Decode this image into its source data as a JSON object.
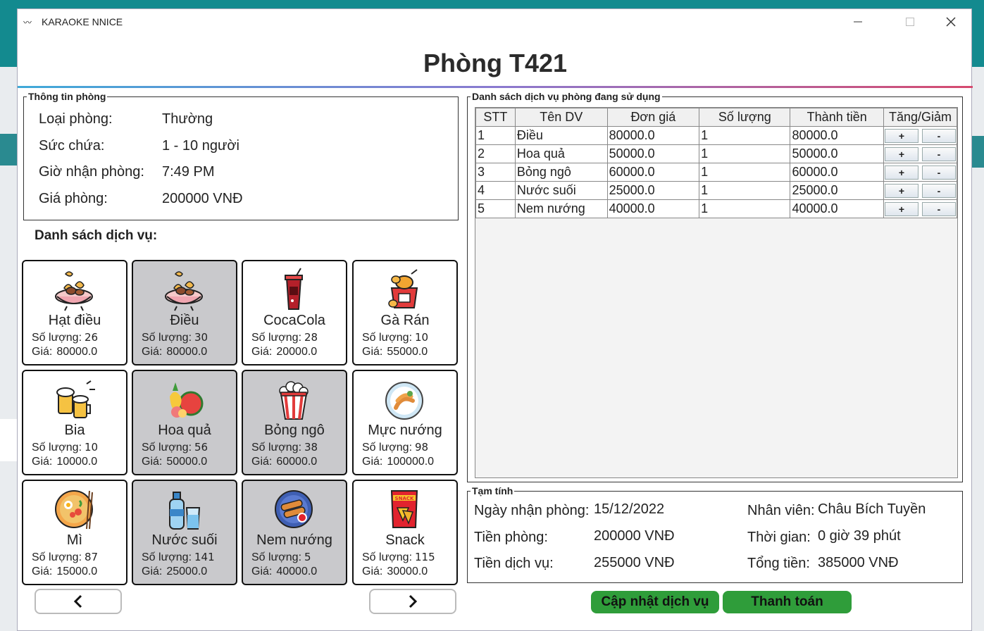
{
  "window": {
    "title": "KARAOKE NNICE"
  },
  "room": {
    "title": "Phòng T421"
  },
  "room_info": {
    "legend": "Thông tin phòng",
    "rows": [
      {
        "label": "Loại phòng:",
        "value": "Thường"
      },
      {
        "label": "Sức chứa:",
        "value": "1 - 10 người"
      },
      {
        "label": "Giờ nhận phòng:",
        "value": "7:49 PM"
      },
      {
        "label": "Giá phòng:",
        "value": "200000 VNĐ"
      }
    ]
  },
  "services": {
    "heading": "Danh sách dịch vụ:",
    "qty_label": "Số lượng:",
    "price_label": "Giá:",
    "items": [
      {
        "name": "Hạt điều",
        "qty": "26",
        "price": "80000.0",
        "icon": "cashew-icon",
        "selected": false
      },
      {
        "name": "Điều",
        "qty": "30",
        "price": "80000.0",
        "icon": "cashew-icon",
        "selected": true
      },
      {
        "name": "CocaCola",
        "qty": "28",
        "price": "20000.0",
        "icon": "soda-cup-icon",
        "selected": false
      },
      {
        "name": "Gà Rán",
        "qty": "10",
        "price": "55000.0",
        "icon": "fried-chicken-icon",
        "selected": false
      },
      {
        "name": "Bia",
        "qty": "10",
        "price": "10000.0",
        "icon": "beer-icon",
        "selected": false
      },
      {
        "name": "Hoa quả",
        "qty": "56",
        "price": "50000.0",
        "icon": "fruit-icon",
        "selected": true
      },
      {
        "name": "Bỏng ngô",
        "qty": "38",
        "price": "60000.0",
        "icon": "popcorn-icon",
        "selected": true
      },
      {
        "name": "Mực nướng",
        "qty": "98",
        "price": "100000.0",
        "icon": "grilled-squid-icon",
        "selected": false
      },
      {
        "name": "Mì",
        "qty": "87",
        "price": "15000.0",
        "icon": "noodle-bowl-icon",
        "selected": false
      },
      {
        "name": "Nước suối",
        "qty": "141",
        "price": "25000.0",
        "icon": "water-bottle-icon",
        "selected": true
      },
      {
        "name": "Nem nướng",
        "qty": "5",
        "price": "40000.0",
        "icon": "grilled-sausage-icon",
        "selected": true
      },
      {
        "name": "Snack",
        "qty": "115",
        "price": "30000.0",
        "icon": "snack-bag-icon",
        "selected": false
      }
    ],
    "prev": "‹",
    "next": "›"
  },
  "used_services": {
    "legend": "Danh sách dịch vụ phòng đang sử dụng",
    "columns": [
      "STT",
      "Tên DV",
      "Đơn giá",
      "Số lượng",
      "Thành tiền",
      "Tăng/Giảm"
    ],
    "plus": "+",
    "minus": "-",
    "rows": [
      [
        "1",
        "Điều",
        "80000.0",
        "1",
        "80000.0"
      ],
      [
        "2",
        "Hoa quả",
        "50000.0",
        "1",
        "50000.0"
      ],
      [
        "3",
        "Bỏng ngô",
        "60000.0",
        "1",
        "60000.0"
      ],
      [
        "4",
        "Nước suối",
        "25000.0",
        "1",
        "25000.0"
      ],
      [
        "5",
        "Nem nướng",
        "40000.0",
        "1",
        "40000.0"
      ]
    ]
  },
  "summary": {
    "legend": "Tạm tính",
    "checkin_date_label": "Ngày nhận phòng:",
    "checkin_date": "15/12/2022",
    "room_fee_label": "Tiền phòng:",
    "room_fee": "200000 VNĐ",
    "service_fee_label": "Tiền dịch vụ:",
    "service_fee": "255000 VNĐ",
    "staff_label": "Nhân viên:",
    "staff": "Châu Bích Tuyền",
    "duration_label": "Thời gian:",
    "duration": "0 giờ 39 phút",
    "total_label": "Tổng tiền:",
    "total": "385000 VNĐ"
  },
  "actions": {
    "update": "Cập nhật dịch vụ",
    "pay": "Thanh toán"
  },
  "colors": {
    "accent_green": "#2f9d3a",
    "selected_card": "#c9c9cc",
    "background_teal": "#1b7f86"
  }
}
